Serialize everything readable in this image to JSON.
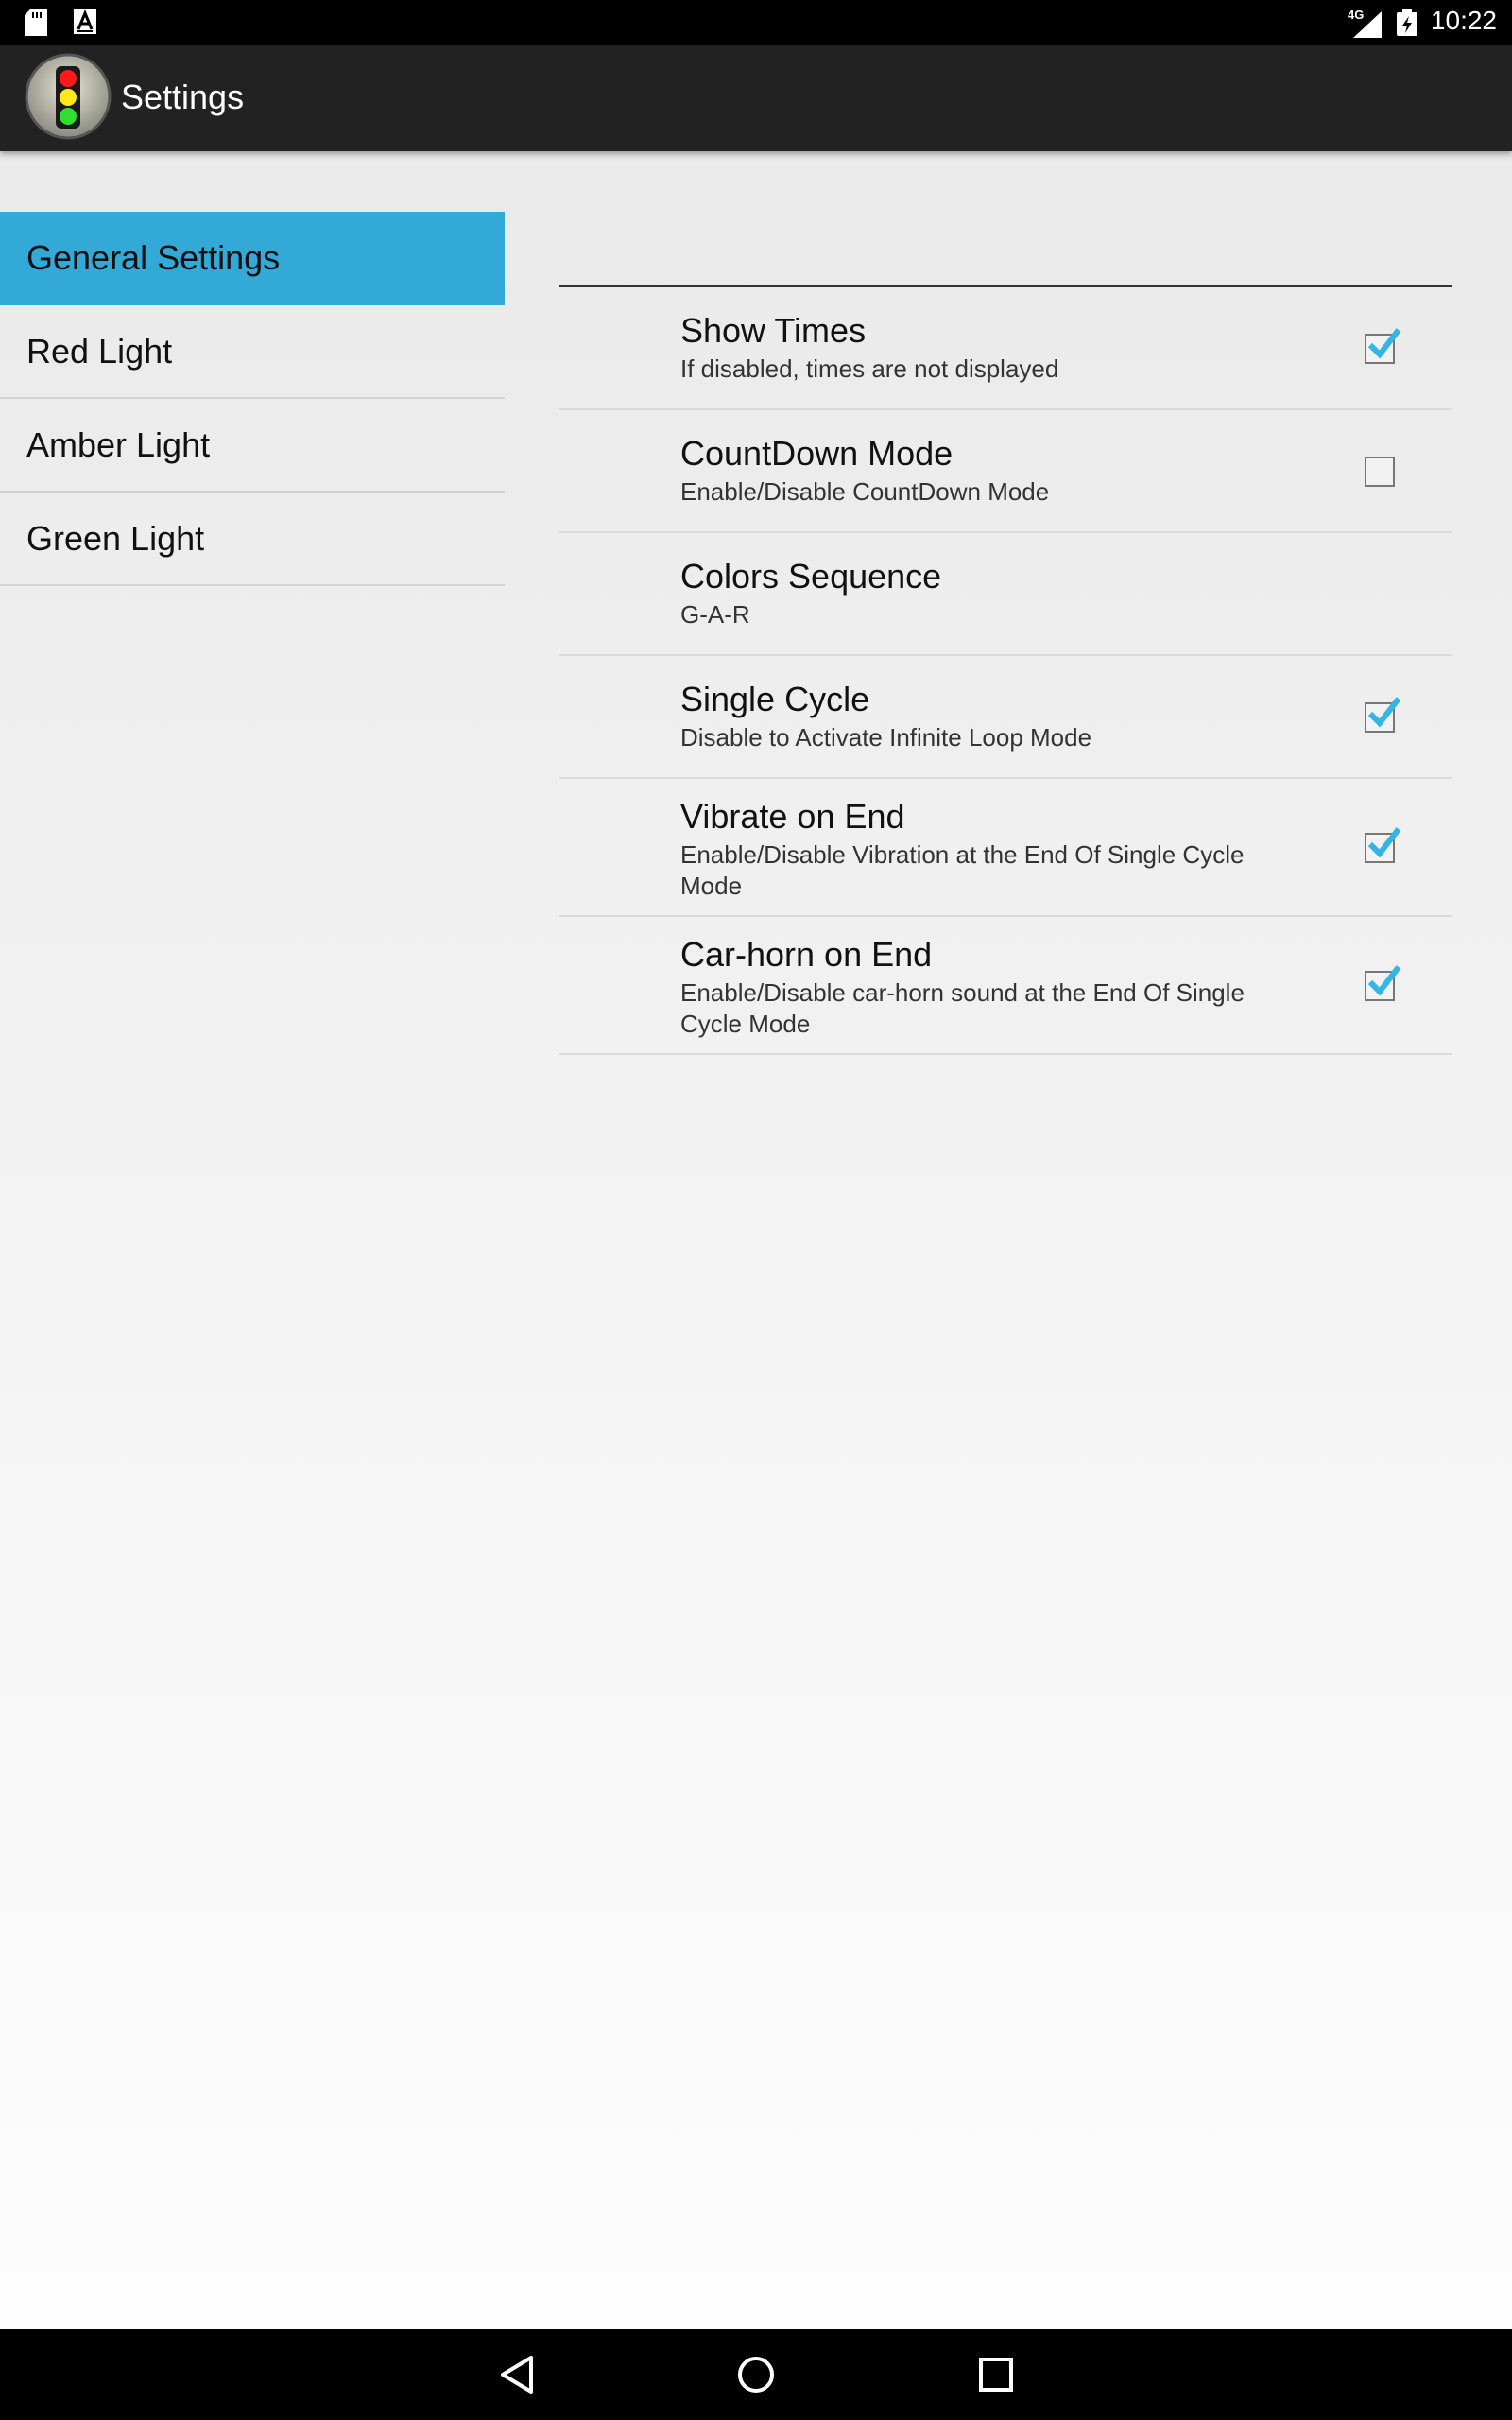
{
  "status_bar": {
    "time": "10:22",
    "network": "4G",
    "icons": [
      "sd-card-icon",
      "a-icon",
      "signal-icon",
      "battery-icon"
    ]
  },
  "action_bar": {
    "title": "Settings",
    "icon": "traffic-light-icon"
  },
  "headers": [
    {
      "label": "General Settings",
      "selected": true
    },
    {
      "label": "Red Light",
      "selected": false
    },
    {
      "label": "Amber Light",
      "selected": false
    },
    {
      "label": "Green Light",
      "selected": false
    }
  ],
  "preferences": [
    {
      "title": "Show Times",
      "summary": "If disabled, times are not displayed",
      "checked": true
    },
    {
      "title": "CountDown Mode",
      "summary": "Enable/Disable CountDown Mode",
      "checked": false
    },
    {
      "title": "Colors Sequence",
      "summary": "G-A-R",
      "checked": null
    },
    {
      "title": "Single Cycle",
      "summary": "Disable to Activate Infinite Loop Mode",
      "checked": true
    },
    {
      "title": "Vibrate on End",
      "summary": "Enable/Disable Vibration at the End Of Single Cycle Mode",
      "checked": true
    },
    {
      "title": "Car-horn on End",
      "summary": "Enable/Disable car-horn sound at the End Of Single Cycle Mode",
      "checked": true
    }
  ],
  "colors": {
    "selected_header": "#33a9d8",
    "checkmark": "#33b5e5",
    "action_bar": "#222222"
  },
  "nav_bar": {
    "buttons": [
      "back-icon",
      "home-icon",
      "recents-icon"
    ]
  }
}
